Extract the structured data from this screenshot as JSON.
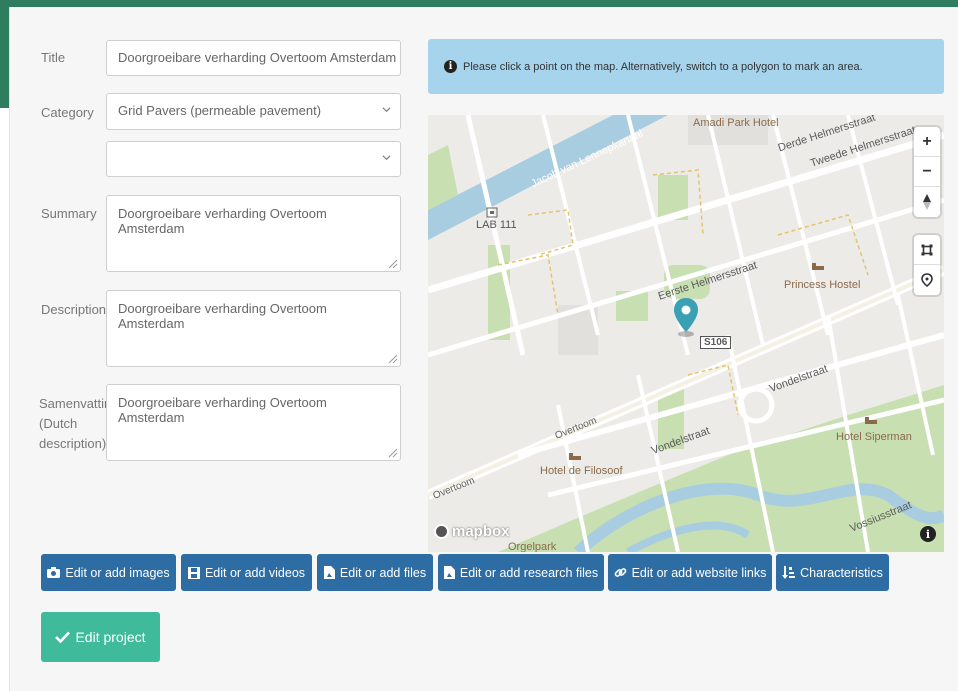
{
  "form": {
    "title_label": "Title",
    "title_value": "Doorgroeibare verharding Overtoom Amsterdam",
    "category_label": "Category",
    "category_value": "Grid Pavers (permeable pavement)",
    "subcategory_value": "",
    "summary_label": "Summary",
    "summary_value": "Doorgroeibare verharding Overtoom Amsterdam",
    "description_label": "Description",
    "description_value": "Doorgroeibare verharding Overtoom Amsterdam",
    "dutch_label_line1": "Samenvattin",
    "dutch_label_line2": "(Dutch",
    "dutch_label_line3": "description)",
    "dutch_value": "Doorgroeibare verharding Overtoom Amsterdam"
  },
  "alert": {
    "text": "Please click a point on the map. Alternatively, switch to a polygon to mark an area."
  },
  "map": {
    "labels": {
      "canal": "Jacob van Lennepkanaal",
      "amadi": "Amadi Park Hotel",
      "derde": "Derde Helmersstraat",
      "tweede": "Tweede Helmersstraat",
      "lab": "LAB 111",
      "eerste": "Eerste Helmersstraat",
      "princess": "Princess Hostel",
      "route": "S106",
      "vondel1": "Vondelstraat",
      "vondel2": "Vondelstraat",
      "overtoom1": "Overtoom",
      "overtoom2": "Overtoom",
      "filosoof": "Hotel de Filosoof",
      "siperman": "Hotel Siperman",
      "vossius": "Vossiusstraat",
      "orgelpark": "Orgelpark",
      "mapbox": "mapbox"
    },
    "controls": {
      "zoom_in": "+",
      "zoom_out": "−"
    }
  },
  "buttons": {
    "images": "Edit or add images",
    "videos": "Edit or add videos",
    "files": "Edit or add files",
    "research": "Edit or add research files",
    "links": "Edit or add website links",
    "characteristics": "Characteristics",
    "edit_project": "Edit project"
  },
  "colors": {
    "accent_green": "#2e7d5e",
    "button_blue": "#2e6da4",
    "edit_teal": "#3fbb9c",
    "alert_blue": "#a6d4ec",
    "marker": "#3aa0b3"
  }
}
